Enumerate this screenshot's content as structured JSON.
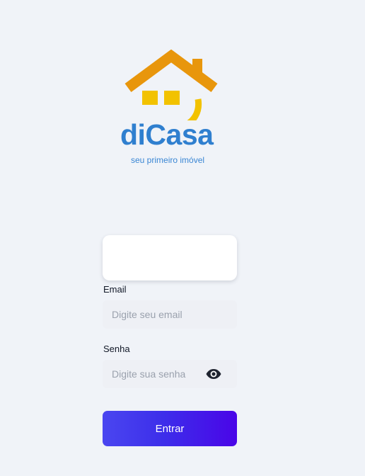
{
  "logo": {
    "brand": "diCasa",
    "tagline": "seu primeiro imóvel",
    "roof_color": "#e8960c",
    "face_color": "#f2c200",
    "text_color": "#2f7fcf"
  },
  "form": {
    "email": {
      "label": "Email",
      "placeholder": "Digite seu email",
      "value": ""
    },
    "password": {
      "label": "Senha",
      "placeholder": "Digite sua senha",
      "value": "",
      "toggle_icon": "eye-icon"
    },
    "submit_label": "Entrar",
    "accent_color": "#4a05e8"
  }
}
